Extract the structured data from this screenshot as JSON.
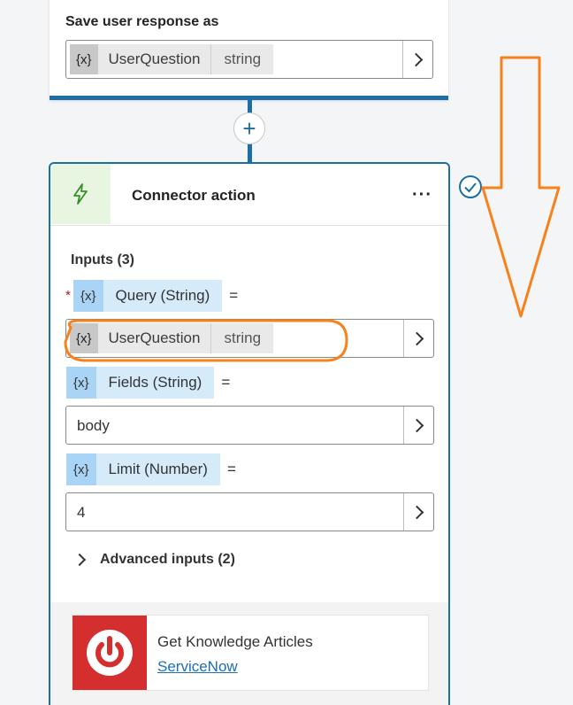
{
  "save_response": {
    "label": "Save user response as",
    "variable": {
      "prefix": "{x}",
      "name": "UserQuestion",
      "type": "string"
    }
  },
  "connector_action": {
    "title": "Connector action",
    "more_icon": "ellipsis-icon",
    "header_icon": "lightning-bolt-icon",
    "inputs_title": "Inputs (3)",
    "params": [
      {
        "prefix": "{x}",
        "name": "Query (String)",
        "eq": "=",
        "required": true,
        "value": {
          "prefix": "{x}",
          "name": "UserQuestion",
          "type": "string"
        }
      },
      {
        "prefix": "{x}",
        "name": "Fields (String)",
        "eq": "=",
        "value_text": "body"
      },
      {
        "prefix": "{x}",
        "name": "Limit (Number)",
        "eq": "=",
        "value_text": "4"
      }
    ],
    "advanced": "Advanced inputs (2)",
    "required_mark": "*"
  },
  "service": {
    "title": "Get Knowledge Articles",
    "link": "ServiceNow",
    "logo_icon": "power-icon"
  },
  "annotations": {
    "arrow": "down-arrow-annotation",
    "highlight": "ellipse-highlight",
    "color": "#f7821b"
  },
  "colors": {
    "accent": "#1e6ea6",
    "variable_tag": "#a9d4f5",
    "servicenow_red": "#d42e2e"
  }
}
